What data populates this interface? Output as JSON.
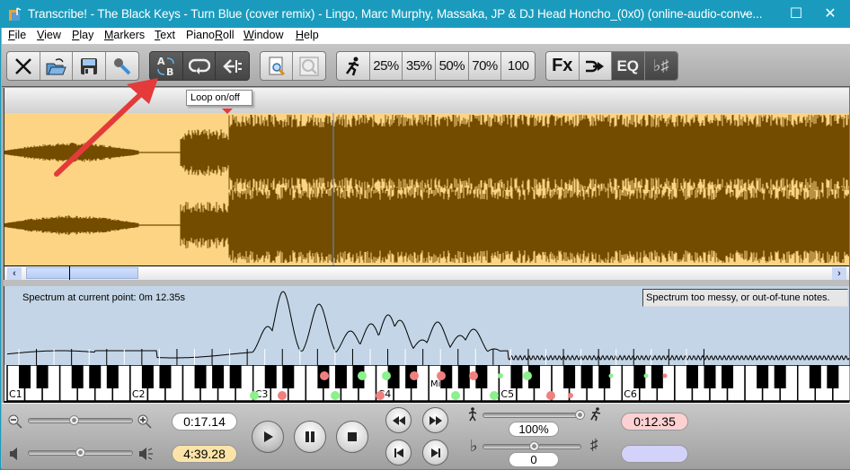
{
  "titlebar": {
    "title": "Transcribe! - The Black Keys - Turn Blue (cover remix) - Lingo, Marc Murphy, Massaka, JP & DJ Head Honcho_(0x0) (online-audio-conve...",
    "minimize_icon": "minimize-icon",
    "maximize_icon": "maximize-icon",
    "close_icon": "close-icon"
  },
  "menu": [
    {
      "label": "File",
      "accel": "F"
    },
    {
      "label": "View",
      "accel": "V"
    },
    {
      "label": "Play",
      "accel": "P"
    },
    {
      "label": "Markers",
      "accel": "M"
    },
    {
      "label": "Text",
      "accel": "T"
    },
    {
      "label": "PianoRoll",
      "accel": "R"
    },
    {
      "label": "Window",
      "accel": "W"
    },
    {
      "label": "Help",
      "accel": "H"
    }
  ],
  "toolbar": {
    "file_group": [
      {
        "name": "close-file",
        "icon": "close-x-icon"
      },
      {
        "name": "open-file",
        "icon": "open-folder-icon"
      },
      {
        "name": "save-file",
        "icon": "floppy-disk-icon"
      },
      {
        "name": "record",
        "icon": "microphone-icon"
      }
    ],
    "loop_group": [
      {
        "name": "ab-loop",
        "icon": "ab-loop-icon",
        "label_a": "A",
        "label_b": "B",
        "selected": true
      },
      {
        "name": "loop-toggle",
        "icon": "loop-icon",
        "selected": true
      },
      {
        "name": "loop-back",
        "icon": "back-to-marker-icon",
        "selected": true
      }
    ],
    "zoom_group": [
      {
        "name": "zoom-in-page",
        "icon": "page-zoom-icon"
      },
      {
        "name": "zoom-fit",
        "icon": "magnifier-icon"
      }
    ],
    "speed_group": {
      "icon": "running-man-icon",
      "speeds": [
        "25%",
        "35%",
        "50%",
        "70%",
        "100"
      ]
    },
    "fx_group": [
      {
        "name": "fx",
        "label": "Fx"
      },
      {
        "name": "karaoke",
        "icon": "arrow-right-icon"
      },
      {
        "name": "eq",
        "label": "EQ",
        "selected": true
      },
      {
        "name": "transpose",
        "label": "♭♯",
        "selected": true
      }
    ]
  },
  "tooltip": "Loop on/off",
  "spectrum": {
    "label": "Spectrum at current point: 0m 12.35s",
    "message": "Spectrum too messy, or out-of-tune notes."
  },
  "piano": {
    "octave_labels": [
      "C1",
      "C2",
      "C3",
      "C4",
      "C5",
      "C6"
    ],
    "marker_label": "Mi",
    "notes_green": [
      "C3-1",
      "D#3",
      "F3",
      "F#3",
      "C4-1",
      "D4",
      "F#4",
      "A#4",
      "C#5"
    ],
    "notes_red": [
      "A2",
      "C3",
      "B2",
      "C#3",
      "G#3",
      "C#4",
      "D#4",
      "G4",
      "D5"
    ]
  },
  "controls": {
    "zoom_slider": {
      "value": 0.45,
      "minus_icon": "zoom-out-icon",
      "plus_icon": "zoom-in-icon"
    },
    "volume_slider": {
      "value": 0.5,
      "low_icon": "speaker-low-icon",
      "high_icon": "speaker-high-icon"
    },
    "position_time": "0:17.14",
    "total_time": "4:39.28",
    "play_icon": "play-icon",
    "pause_icon": "pause-icon",
    "stop_icon": "stop-icon",
    "rewind_icon": "rewind-icon",
    "fast_forward_icon": "fast-forward-icon",
    "goto_start_icon": "skip-to-start-icon",
    "goto_end_icon": "skip-to-end-icon",
    "speed_slider": {
      "value": 1.0,
      "slow_icon": "walking-man-icon",
      "fast_icon": "running-man-icon"
    },
    "speed_value": "100%",
    "pitch_slider": {
      "value": 0.5,
      "flat_symbol": "♭",
      "sharp_symbol": "♯"
    },
    "pitch_value": "0",
    "spectrum_time": "0:12.35",
    "extra_time": ""
  },
  "colors": {
    "titlebar": "#1a9bbd",
    "waveform_bg": "#fcd483",
    "waveform_fg": "#734c00",
    "spectrum_bg": "#c3d5e6",
    "note_green": "#8cf08c",
    "note_red": "#f08080",
    "spectrum_time_bg": "#fdd1d1",
    "total_time_bg": "#fbe4a8",
    "annotation_arrow": "#e53a3a"
  }
}
